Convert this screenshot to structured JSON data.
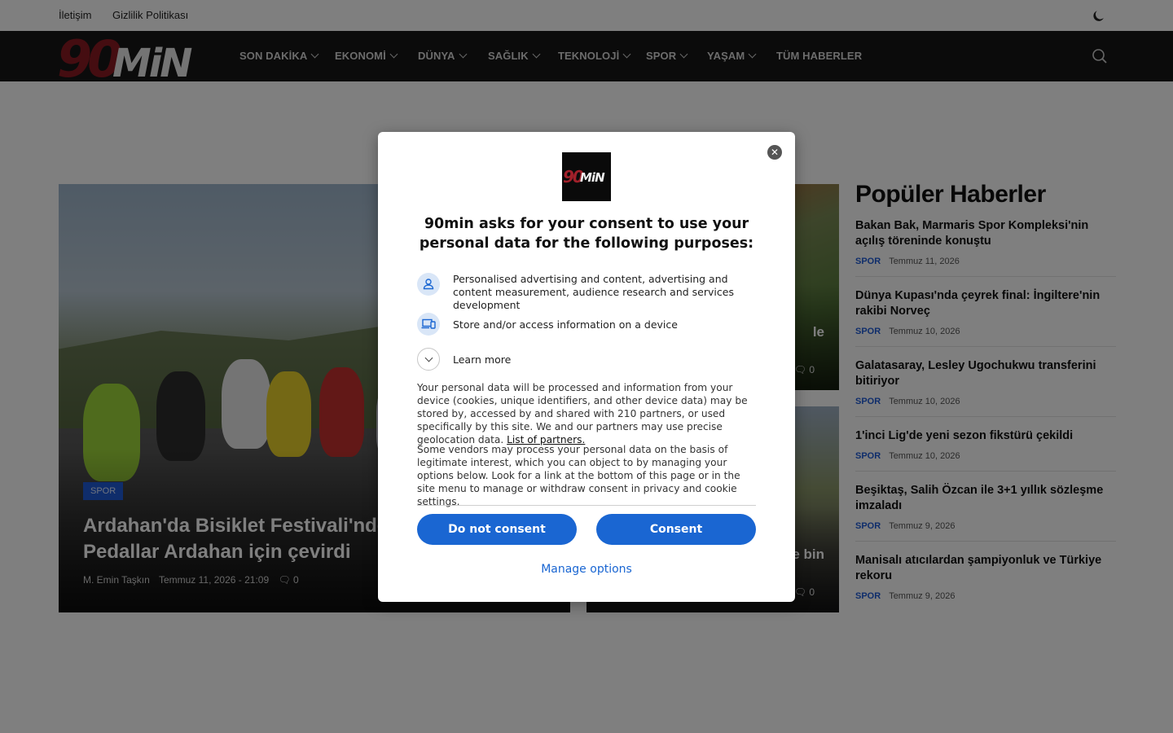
{
  "topbar": {
    "links": [
      "İletişim",
      "Gizlilik Politikası"
    ],
    "theme_toggle_icon": "moon-icon"
  },
  "navbar": {
    "logo_text": "90MiN",
    "items": [
      "SON DAKİKA",
      "EKONOMİ",
      "DÜNYA",
      "SAĞLIK",
      "TEKNOLOJİ",
      "SPOR",
      "YAŞAM",
      "TÜM HABERLER"
    ],
    "search_icon": "search-icon"
  },
  "hero": {
    "category": "SPOR",
    "title": "Ardahan'da Bisiklet Festivali'nde renkli görüntüler: Pedallar Ardahan için çevirdi",
    "author": "M. Emin Taşkın",
    "date": "Temmuz 11, 2026 - 21:09",
    "comments": "0"
  },
  "side_cards": [
    {
      "title_fragment": "le",
      "comments": "0"
    },
    {
      "title_fragment": "e bin",
      "comments": "0"
    }
  ],
  "popular": {
    "heading": "Popüler Haberler",
    "items": [
      {
        "title": "Bakan Bak, Marmaris Spor Kompleksi'nin açılış töreninde konuştu",
        "category": "SPOR",
        "date": "Temmuz 11, 2026"
      },
      {
        "title": "Dünya Kupası'nda çeyrek final: İngiltere'nin rakibi Norveç",
        "category": "SPOR",
        "date": "Temmuz 10, 2026"
      },
      {
        "title": "Galatasaray, Lesley Ugochukwu transferini bitiriyor",
        "category": "SPOR",
        "date": "Temmuz 10, 2026"
      },
      {
        "title": "1'inci Lig'de yeni sezon fikstürü çekildi",
        "category": "SPOR",
        "date": "Temmuz 10, 2026"
      },
      {
        "title": "Beşiktaş, Salih Özcan ile 3+1 yıllık sözleşme imzaladı",
        "category": "SPOR",
        "date": "Temmuz 9, 2026"
      },
      {
        "title": "Manisalı atıcılardan şampiyonluk ve Türkiye rekoru",
        "category": "SPOR",
        "date": "Temmuz 9, 2026"
      }
    ]
  },
  "consent": {
    "close_icon": "close-icon",
    "logo_text": "90MiN",
    "title": "90min asks for your consent to use your personal data for the following purposes:",
    "purposes": [
      {
        "icon": "person-icon",
        "text": "Personalised advertising and content, advertising and content measurement, audience research and services development"
      },
      {
        "icon": "devices-icon",
        "text": "Store and/or access information on a device"
      }
    ],
    "learn_more": "Learn more",
    "paragraph1": "Your personal data will be processed and information from your device (cookies, unique identifiers, and other device data) may be stored by, accessed by and shared with 210 partners, or used specifically by this site. We and our partners may use precise geolocation data.",
    "partners_link": "List of partners.",
    "paragraph2": "Some vendors may process your personal data on the basis of legitimate interest, which you can object to by managing your options below. Look for a link at the bottom of this page or in the site menu to manage or withdraw consent in privacy and cookie settings.",
    "do_not_consent": "Do not consent",
    "consent": "Consent",
    "manage_options": "Manage options"
  }
}
